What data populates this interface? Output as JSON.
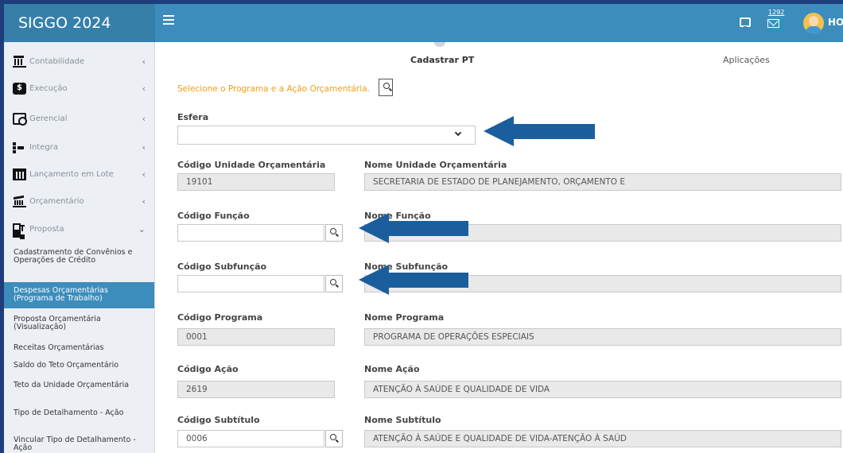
{
  "app": {
    "title": "SIGGO 2024",
    "user_name": "HO",
    "mail_count": "1292"
  },
  "sidebar": {
    "items": [
      {
        "label": "Contabilidade",
        "icon": "bank-icon"
      },
      {
        "label": "Execução",
        "icon": "money-icon"
      },
      {
        "label": "Gerencial",
        "icon": "document-search-icon"
      },
      {
        "label": "Integra",
        "icon": "integration-icon"
      },
      {
        "label": "Lançamento em Lote",
        "icon": "calendar-icon"
      },
      {
        "label": "Orçamentário",
        "icon": "budget-icon"
      },
      {
        "label": "Proposta",
        "icon": "proposal-icon"
      }
    ],
    "sub_items": [
      "Cadastramento de Convênios e Operações de Crédito",
      "Despesas Orçamentárias (Programa de Trabalho)",
      "Proposta Orçamentária (Visualização)",
      "Receitas Orçamentárias",
      "Saldo do Teto Orçamentário",
      "Teto da Unidade Orçamentária",
      "Tipo de Detalhamento - Ação",
      "Vincular Tipo de Detalhamento - Ação"
    ]
  },
  "tabs": {
    "cadastrar": "Cadastrar PT",
    "aplicacoes": "Aplicações"
  },
  "form": {
    "select_prompt": "Selecione o Programa e a Ação Orçamentária.",
    "esfera": {
      "label": "Esfera",
      "value": ""
    },
    "cod_unidade": {
      "label": "Código Unidade Orçamentária",
      "value": "19101"
    },
    "nome_unidade": {
      "label": "Nome Unidade Orçamentária",
      "value": "SECRETARIA DE ESTADO DE PLANEJAMENTO, ORÇAMENTO E"
    },
    "cod_funcao": {
      "label": "Código Função",
      "value": ""
    },
    "nome_funcao": {
      "label": "Nome Função",
      "value": ""
    },
    "cod_subfuncao": {
      "label": "Código Subfunção",
      "value": ""
    },
    "nome_subfuncao": {
      "label": "Nome Subfunção",
      "value": ""
    },
    "cod_programa": {
      "label": "Código Programa",
      "value": "0001"
    },
    "nome_programa": {
      "label": "Nome Programa",
      "value": "PROGRAMA DE OPERAÇÕES ESPECIAIS"
    },
    "cod_acao": {
      "label": "Código Ação",
      "value": "2619"
    },
    "nome_acao": {
      "label": "Nome Ação",
      "value": "ATENÇÃO À SAÚDE E QUALIDADE DE VIDA"
    },
    "cod_subtitulo": {
      "label": "Código Subtítulo",
      "value": "0006"
    },
    "nome_subtitulo": {
      "label": "Nome Subtítulo",
      "value": "ATENÇÃO À SAÚDE E QUALIDADE DE VIDA-ATENÇÃO À SAÚD"
    }
  },
  "colors": {
    "topbar": "#3c8dbc",
    "logo_bg": "#367fa9",
    "active_item": "#3c8dbc",
    "prompt_text": "#f39c12",
    "annotation_arrow": "#1b5e9e",
    "frame_border": "#1f3d7a"
  }
}
